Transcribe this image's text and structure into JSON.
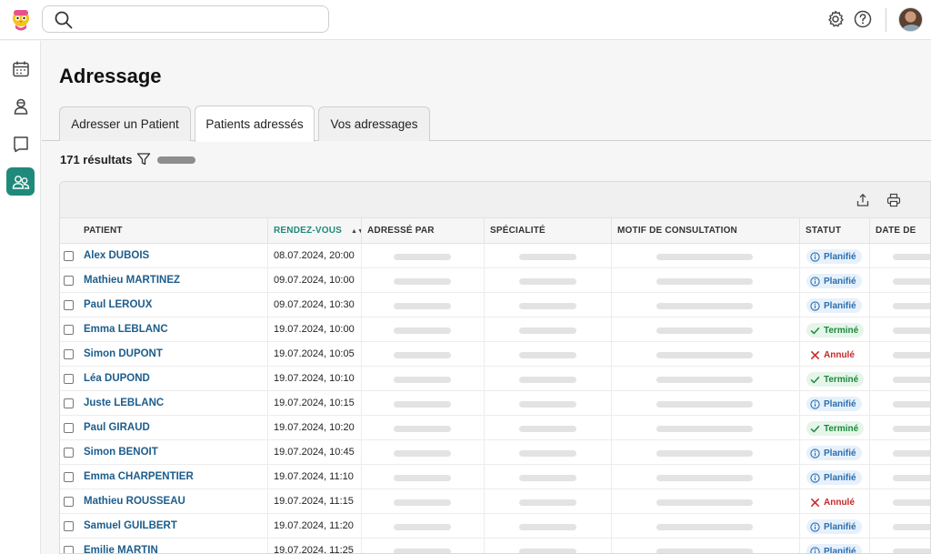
{
  "header": {
    "search_placeholder": "",
    "icons": [
      "logo-icon",
      "search-icon",
      "gear-icon",
      "help-icon",
      "avatar"
    ]
  },
  "sidebar": {
    "items": [
      {
        "name": "calendar-icon",
        "active": false
      },
      {
        "name": "patient-icon",
        "active": false
      },
      {
        "name": "bookmark-icon",
        "active": false
      },
      {
        "name": "referral-icon",
        "active": true
      }
    ],
    "active_color": "#1f8a7a"
  },
  "page": {
    "title": "Adressage",
    "tabs": [
      {
        "label": "Adresser un Patient",
        "active": false
      },
      {
        "label": "Patients adressés",
        "active": true
      },
      {
        "label": "Vos adressages",
        "active": false
      }
    ],
    "results": "171 résultats"
  },
  "table": {
    "columns": {
      "patient": "PATIENT",
      "rdv": "RENDEZ-VOUS",
      "adresse_par": "ADRESSÉ PAR",
      "specialite": "SPÉCIALITÉ",
      "motif": "MOTIF DE CONSULTATION",
      "statut": "STATUT",
      "date": "DATE DE"
    },
    "sort_indicator": "▲▼",
    "rows": [
      {
        "name": "Alex DUBOIS",
        "rdv": "08.07.2024, 20:00",
        "status": "Planifié",
        "kind": "planned"
      },
      {
        "name": "Mathieu MARTINEZ",
        "rdv": "09.07.2024, 10:00",
        "status": "Planifié",
        "kind": "planned"
      },
      {
        "name": "Paul LEROUX",
        "rdv": "09.07.2024, 10:30",
        "status": "Planifié",
        "kind": "planned"
      },
      {
        "name": "Emma LEBLANC",
        "rdv": "19.07.2024, 10:00",
        "status": "Terminé",
        "kind": "done"
      },
      {
        "name": "Simon DUPONT",
        "rdv": "19.07.2024, 10:05",
        "status": "Annulé",
        "kind": "cancel"
      },
      {
        "name": "Léa DUPOND",
        "rdv": "19.07.2024, 10:10",
        "status": "Terminé",
        "kind": "done"
      },
      {
        "name": "Juste LEBLANC",
        "rdv": "19.07.2024, 10:15",
        "status": "Planifié",
        "kind": "planned"
      },
      {
        "name": "Paul GIRAUD",
        "rdv": "19.07.2024, 10:20",
        "status": "Terminé",
        "kind": "done"
      },
      {
        "name": "Simon BENOIT",
        "rdv": "19.07.2024, 10:45",
        "status": "Planifié",
        "kind": "planned"
      },
      {
        "name": "Emma CHARPENTIER",
        "rdv": "19.07.2024, 11:10",
        "status": "Planifié",
        "kind": "planned"
      },
      {
        "name": "Mathieu ROUSSEAU",
        "rdv": "19.07.2024, 11:15",
        "status": "Annulé",
        "kind": "cancel"
      },
      {
        "name": "Samuel GUILBERT",
        "rdv": "19.07.2024, 11:20",
        "status": "Planifié",
        "kind": "planned"
      },
      {
        "name": "Emilie MARTIN",
        "rdv": "19.07.2024, 11:25",
        "status": "Planifié",
        "kind": "planned"
      }
    ]
  }
}
